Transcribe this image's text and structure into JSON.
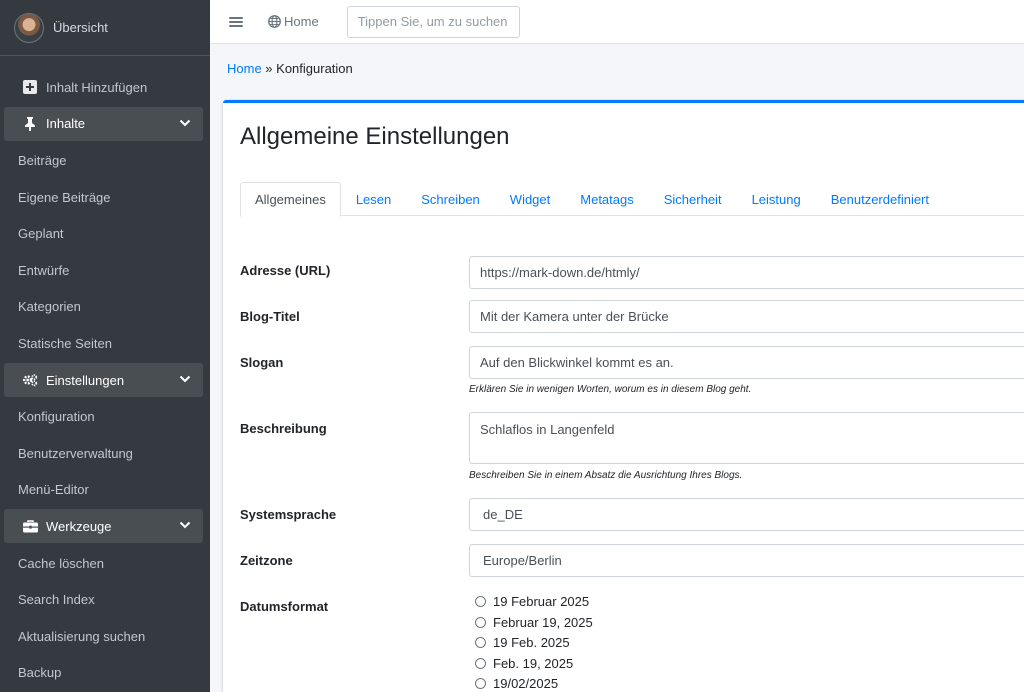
{
  "sidebar": {
    "user_name": "Übersicht",
    "add_content": "Inhalt Hinzufügen",
    "sections": {
      "content": {
        "label": "Inhalte",
        "items": [
          "Beiträge",
          "Eigene Beiträge",
          "Geplant",
          "Entwürfe",
          "Kategorien",
          "Statische Seiten"
        ]
      },
      "settings": {
        "label": "Einstellungen",
        "items": [
          "Konfiguration",
          "Benutzerverwaltung",
          "Menü-Editor"
        ]
      },
      "tools": {
        "label": "Werkzeuge",
        "items": [
          "Cache löschen",
          "Search Index",
          "Aktualisierung suchen",
          "Backup"
        ]
      }
    }
  },
  "topbar": {
    "home_label": "Home",
    "search_placeholder": "Tippen Sie, um zu suchen"
  },
  "breadcrumb": {
    "home": "Home",
    "separator": " » ",
    "current": "Konfiguration"
  },
  "page": {
    "title": "Allgemeine Einstellungen",
    "tabs": [
      "Allgemeines",
      "Lesen",
      "Schreiben",
      "Widget",
      "Metatags",
      "Sicherheit",
      "Leistung",
      "Benutzerdefiniert"
    ],
    "active_tab": "Allgemeines"
  },
  "form": {
    "url": {
      "label": "Adresse (URL)",
      "value": "https://mark-down.de/htmly/"
    },
    "blog_title": {
      "label": "Blog-Titel",
      "value": "Mit der Kamera unter der Brücke"
    },
    "slogan": {
      "label": "Slogan",
      "value": "Auf den Blickwinkel kommt es an.",
      "help": "Erklären Sie in wenigen Worten, worum es in diesem Blog geht."
    },
    "description": {
      "label": "Beschreibung",
      "value": "Schlaflos in Langenfeld",
      "help": "Beschreiben Sie in einem Absatz die Ausrichtung Ihres Blogs."
    },
    "language": {
      "label": "Systemsprache",
      "value": "de_DE"
    },
    "timezone": {
      "label": "Zeitzone",
      "value": "Europe/Berlin"
    },
    "date_format": {
      "label": "Datumsformat",
      "options": [
        "19 Februar 2025",
        "Februar 19, 2025",
        "19 Feb. 2025",
        "Feb. 19, 2025",
        "19/02/2025"
      ]
    }
  },
  "colors": {
    "sidebar_bg": "#343a40",
    "accent": "#007bff",
    "section_bg": "#494e53"
  }
}
